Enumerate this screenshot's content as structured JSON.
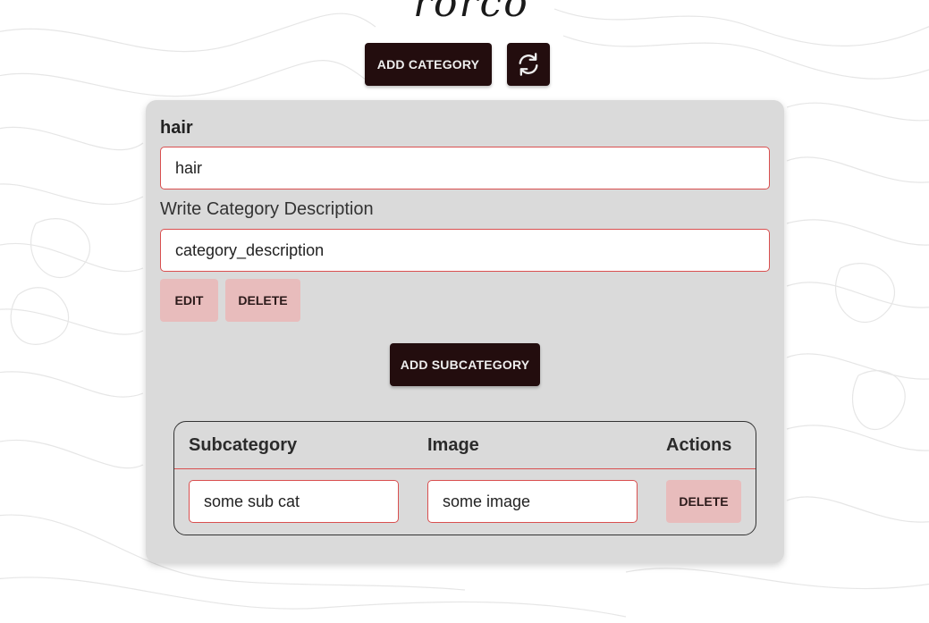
{
  "header": {
    "logo_text": "rorco",
    "add_category_label": "ADD CATEGORY",
    "refresh_icon": "refresh-icon"
  },
  "category": {
    "name_heading": "hair",
    "name_value": "hair",
    "description_label": "Write Category Description",
    "description_value": "category_description",
    "edit_label": "EDIT",
    "delete_label": "DELETE",
    "add_subcategory_label": "ADD SUBCATEGORY"
  },
  "subcategories": {
    "columns": [
      "Subcategory",
      "Image",
      "Actions"
    ],
    "rows": [
      {
        "subcategory": "some sub cat",
        "image": "some image",
        "delete_label": "DELETE"
      }
    ]
  },
  "colors": {
    "dark_button": "#230d0e",
    "pink_button": "#e8bcbc",
    "input_border": "#d94f4f",
    "card_bg": "#dadada"
  }
}
